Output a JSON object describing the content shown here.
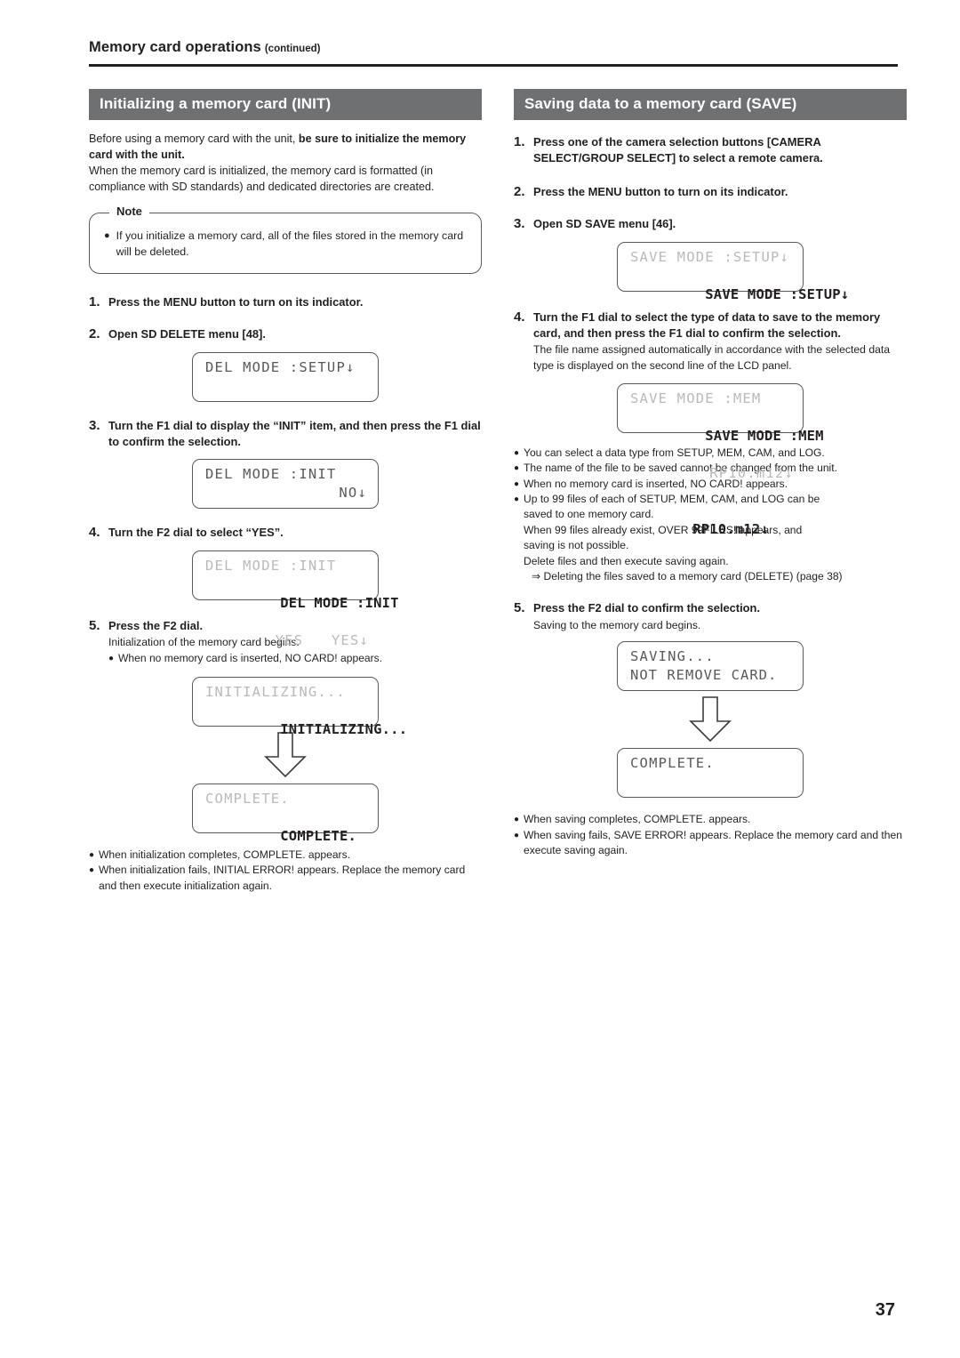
{
  "running_head": {
    "title": "Memory card operations",
    "continued": "(continued)"
  },
  "page_number": "37",
  "colors": {
    "section_bar_bg": "#6e7072",
    "section_bar_text": "#ffffff",
    "lcd_text": "#58595b",
    "body_text": "#231f20"
  },
  "left_column": {
    "section_title": "Initializing a memory card (INIT)",
    "intro": {
      "line1_normal": "Before using a memory card with the unit, ",
      "line1_bold": "be sure to initialize the memory card with the unit.",
      "line2": "When the memory card is initialized, the memory card is formatted (in compliance with SD standards) and dedicated directories are created."
    },
    "note": {
      "label": "Note",
      "bullet": "●",
      "text": "If you initialize a memory card, all of the files stored in the memory card will be deleted."
    },
    "steps": [
      {
        "num": "1.",
        "title": "Press the MENU button to turn on its indicator."
      },
      {
        "num": "2.",
        "title": "Open SD DELETE menu [48].",
        "lcd": {
          "line1": "DEL MODE :SETUP↓",
          "line2": "",
          "style": "plain"
        }
      },
      {
        "num": "3.",
        "title": "Turn the F1 dial to display the “INIT” item, and then press the F1 dial to confirm the selection.",
        "lcd": {
          "line1": "DEL MODE :INIT",
          "line2": "NO↓",
          "style": "plain"
        }
      },
      {
        "num": "4.",
        "title": "Turn the F2 dial to select “YES”.",
        "lcd": {
          "line1": "DEL MODE :INIT",
          "line2": "YES   YES↓",
          "style": "double"
        }
      },
      {
        "num": "5.",
        "title": "Press the F2 dial.",
        "sub": "Initialization of the memory card begins.",
        "bullets": [
          "When no memory card is inserted,  NO CARD!  appears."
        ],
        "lcd_sequence": {
          "first": {
            "line1": "INITIALIZING...",
            "line2": "",
            "style": "double"
          },
          "arrow": "down-arrow",
          "second": {
            "line1": "COMPLETE.",
            "line2": "",
            "style": "double"
          }
        }
      }
    ],
    "closing_bullets": [
      "When initialization completes,  COMPLETE.  appears.",
      "When initialization fails,  INITIAL ERROR!  appears. Replace the memory card and then execute initialization again."
    ]
  },
  "right_column": {
    "section_title": "Saving data to a memory card (SAVE)",
    "steps": [
      {
        "num": "1.",
        "title": "Press one of the camera selection buttons [CAMERA SELECT/GROUP SELECT] to select a remote camera."
      },
      {
        "num": "2.",
        "title": "Press the MENU button to turn on its indicator."
      },
      {
        "num": "3.",
        "title": "Open SD SAVE menu [46].",
        "lcd": {
          "line1": "SAVE MODE :SETUP↓",
          "line2": "",
          "style": "double"
        }
      },
      {
        "num": "4.",
        "title": "Turn the F1 dial to select the type of data to save to the memory card, and then press the F1 dial to confirm the selection.",
        "sub": "The file name assigned automatically in accordance with the selected data type is displayed on the second line of the LCD panel.",
        "lcd": {
          "line1": "SAVE MODE :MEM",
          "line2": "RP10.m12↓",
          "style": "double"
        }
      },
      {
        "num": "5.",
        "title": "Press the F2 dial to confirm the selection.",
        "sub": "Saving to the memory card begins.",
        "lcd_sequence": {
          "first": {
            "line1": "SAVING...",
            "line2": "NOT REMOVE CARD.",
            "style": "plain"
          },
          "arrow": "down-arrow",
          "second": {
            "line1": "COMPLETE.",
            "line2": "",
            "style": "plain"
          }
        }
      }
    ],
    "mid_bullets": [
      "You can select a data type from SETUP, MEM, CAM, and LOG.",
      "The name of the file to be saved cannot be changed from the unit.",
      "When no memory card is inserted,  NO CARD!  appears.",
      "Up to 99 files of each of SETUP, MEM, CAM, and LOG can be"
    ],
    "mid_bullet_cont": [
      "saved to one memory card.",
      "When 99 files already exist,  OVER 99FILES!  appears, and",
      "saving is not possible.",
      "Delete files and then execute saving again."
    ],
    "mid_arrow_line": "⇒  Deleting the files saved to a memory card (DELETE)  (page 38)",
    "closing_bullets": [
      "When saving completes,  COMPLETE.  appears.",
      "When saving fails,  SAVE ERROR!  appears. Replace the memory card and then execute saving again."
    ]
  }
}
